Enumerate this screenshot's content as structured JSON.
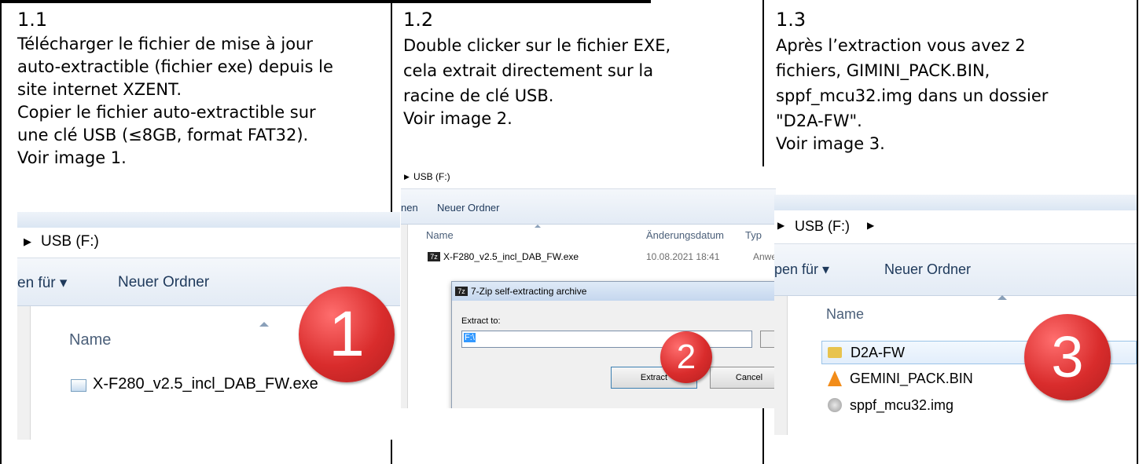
{
  "steps": [
    {
      "number": "1.1",
      "lines": [
        "Télécharger le fichier de mise à jour",
        "auto-extractible (fichier exe) depuis le",
        "site internet XZENT.",
        "Copier le fichier auto-extractible sur",
        "une clé USB (≤8GB, format FAT32).",
        "Voir image 1."
      ],
      "screenshot": {
        "drive": "USB (F:)",
        "open_with": "en für ▾",
        "new_folder": "Neuer Ordner",
        "column_name": "Name",
        "file": "X-F280_v2.5_incl_DAB_FW.exe",
        "badge": "1"
      }
    },
    {
      "number": "1.2",
      "lines": [
        "Double clicker sur le fichier EXE,",
        "cela extrait directement sur la",
        "racine de clé USB.",
        "Voir image 2."
      ],
      "screenshot": {
        "drive": "USB (F:)",
        "open_with": "nen",
        "new_folder": "Neuer Ordner",
        "column_name": "Name",
        "column_date": "Änderungsdatum",
        "column_type": "Typ",
        "file": "X-F280_v2.5_incl_DAB_FW.exe",
        "file_date": "10.08.2021 18:41",
        "file_type": "Anwe",
        "dialog_title": "7-Zip self-extracting archive",
        "extract_to_label": "Extract to:",
        "extract_path": "F:\\",
        "extract_button": "Extract",
        "cancel_button": "Cancel",
        "badge": "2",
        "icon_text": "7z"
      }
    },
    {
      "number": "1.3",
      "lines": [
        "Après l’extraction vous avez 2",
        "fichiers, GIMINI_PACK.BIN,",
        "sppf_mcu32.img dans un dossier",
        "\"D2A-FW\".",
        "Voir image 3."
      ],
      "screenshot": {
        "drive": "USB (F:)",
        "open_with": "pen für ▾",
        "new_folder": "Neuer Ordner",
        "column_name": "Name",
        "items": [
          "D2A-FW",
          "GEMINI_PACK.BIN",
          "sppf_mcu32.img"
        ],
        "badge": "3"
      }
    }
  ]
}
